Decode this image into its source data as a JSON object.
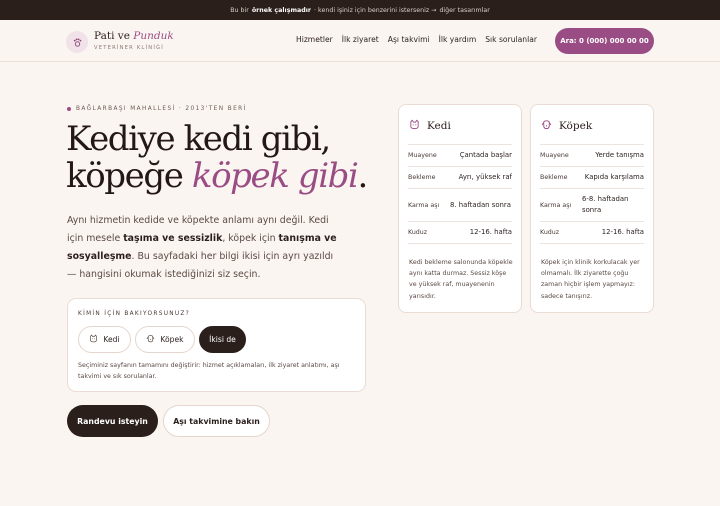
{
  "topbar": {
    "lead": "Bu bir",
    "emph": "örnek çalışmadır",
    "rest": "· kendi işiniz için benzerini isterseniz →",
    "link": "diğer tasarımlar"
  },
  "header": {
    "brand_main": "Pati ve",
    "brand_accent": "Punduk",
    "brand_sub": "VETERİNER KLİNİĞİ",
    "nav": [
      "Hizmetler",
      "İlk ziyaret",
      "Aşı takvimi",
      "İlk yardım",
      "Sık sorulanlar"
    ],
    "call_label": "Ara: 0 (000) 000 00 00"
  },
  "hero": {
    "eyebrow": "BAĞLARBAŞI MAHALLESİ · 2013'TEN BERİ",
    "title_line1": "Kediye kedi gibi,",
    "title_line2_pre": "köpeğe",
    "title_line2_accent": "köpek gibi",
    "title_line2_post": ".",
    "lead_1": "Aynı hizmetin kedide ve köpekte anlamı aynı değil. Kedi için mesele",
    "lead_b1": "taşıma ve sessizlik",
    "lead_2": ", köpek için",
    "lead_b2": "tanışma ve sosyalleşme",
    "lead_3": ". Bu sayfadaki her bilgi ikisi için ayrı yazıldı — hangisini okumak istediğinizi siz seçin."
  },
  "picker": {
    "label": "KİMİN İÇİN BAKIYORSUNUZ?",
    "options": [
      "Kedi",
      "Köpek",
      "İkisi de"
    ],
    "selected": "İkisi de",
    "note": "Seçiminiz sayfanın tamamını değiştirir: hizmet açıklamaları, ilk ziyaret anlatımı, aşı takvimi ve sık sorulanlar."
  },
  "actions": {
    "primary": "Randevu isteyin",
    "secondary": "Aşı takvimine bakın"
  },
  "cards": {
    "cat": {
      "title": "Kedi",
      "rows": [
        {
          "k": "Muayene",
          "v": "Çantada başlar"
        },
        {
          "k": "Bekleme",
          "v": "Ayrı, yüksek raf"
        },
        {
          "k": "Karma aşı",
          "v": "8. haftadan sonra"
        },
        {
          "k": "Kuduz",
          "v": "12-16. hafta"
        }
      ],
      "note": "Kedi bekleme salonunda köpekle aynı katta durmaz. Sessiz köşe ve yüksek raf, muayenenin yarısıdır."
    },
    "dog": {
      "title": "Köpek",
      "rows": [
        {
          "k": "Muayene",
          "v": "Yerde tanışma"
        },
        {
          "k": "Bekleme",
          "v": "Kapıda karşılama"
        },
        {
          "k": "Karma aşı",
          "v": "6-8. haftadan sonra"
        },
        {
          "k": "Kuduz",
          "v": "12-16. hafta"
        }
      ],
      "note": "Köpek için klinik korkulacak yer olmamalı. İlk ziyarette çoğu zaman hiçbir işlem yapmayız: sadece tanışırız."
    }
  },
  "icons": {
    "logo": "paw-icon",
    "cat": "cat-icon",
    "dog": "dog-icon"
  },
  "colors": {
    "accent": "#9a4d84",
    "dark": "#2b1f1c",
    "background": "#fbf5f1"
  }
}
